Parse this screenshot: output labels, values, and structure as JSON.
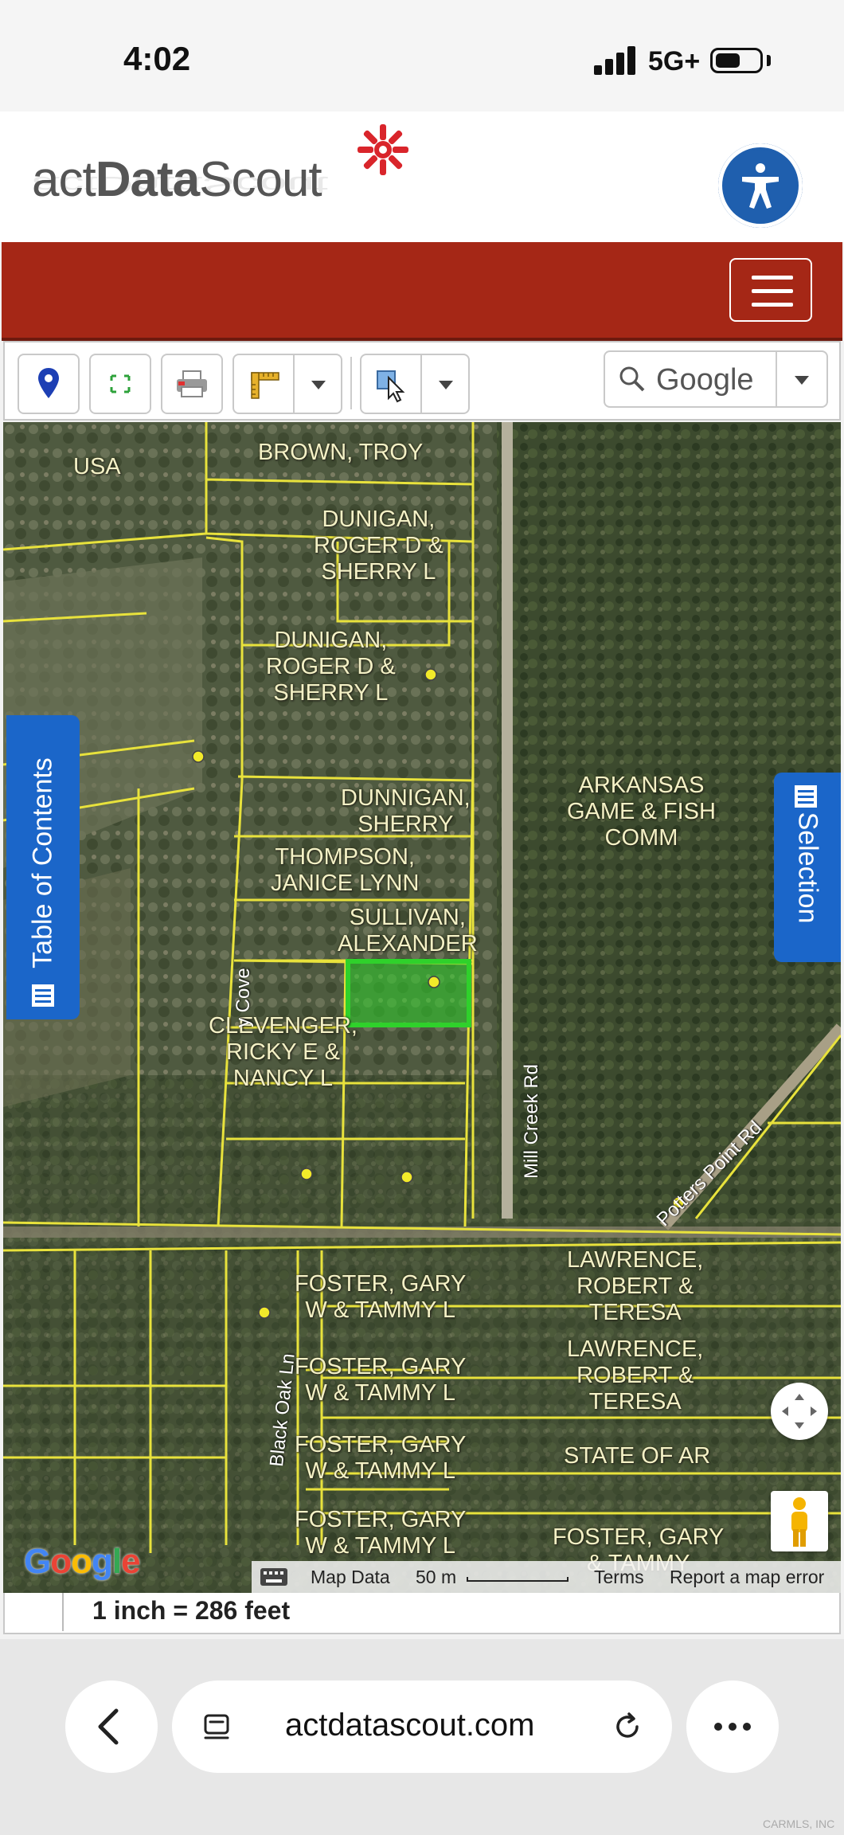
{
  "status_bar": {
    "time": "4:02",
    "network": "5G+"
  },
  "header": {
    "logo_prefix": "act",
    "logo_bold": "Data",
    "logo_suffix": "Scout",
    "accent_color": "#a52716"
  },
  "toolbar": {
    "search_engine_label": "Google"
  },
  "side_tabs": {
    "table_of_contents": "Table of Contents",
    "selection": "Selection"
  },
  "map": {
    "parcels": [
      {
        "label": "USA"
      },
      {
        "label": "BROWN, TROY"
      },
      {
        "line1": "DUNIGAN,",
        "line2": "ROGER D &",
        "line3": "SHERRY L"
      },
      {
        "line1": "DUNIGAN,",
        "line2": "ROGER D &",
        "line3": "SHERRY L"
      },
      {
        "line1": "DUNNIGAN,",
        "line2": "SHERRY"
      },
      {
        "line1": "ARKANSAS",
        "line2": "GAME & FISH",
        "line3": "COMM"
      },
      {
        "line1": "THOMPSON,",
        "line2": "JANICE LYNN"
      },
      {
        "line1": "SULLIVAN,",
        "line2": "ALEXANDER"
      },
      {
        "line1": "CLEVENGER,",
        "line2": "RICKY E &",
        "line3": "NANCY L"
      },
      {
        "line1": "FOSTER, GARY",
        "line2": "W & TAMMY L"
      },
      {
        "line1": "LAWRENCE,",
        "line2": "ROBERT &",
        "line3": "TERESA"
      },
      {
        "line1": "FOSTER, GARY",
        "line2": "W & TAMMY L"
      },
      {
        "line1": "LAWRENCE,",
        "line2": "ROBERT &",
        "line3": "TERESA"
      },
      {
        "line1": "FOSTER, GARY",
        "line2": "W & TAMMY L"
      },
      {
        "label": "STATE OF AR"
      },
      {
        "line1": "FOSTER, GARY",
        "line2": "W & TAMMY L"
      },
      {
        "line1": "FOSTER, GARY",
        "line2": "& TAMMY"
      }
    ],
    "roads": {
      "mill_creek": "Mill Creek Rd",
      "potters_point": "Potters Point Rd",
      "black_oak": "Black Oak Ln",
      "cove": "y Cove"
    },
    "footer": {
      "map_data": "Map Data",
      "scale": "50 m",
      "terms": "Terms",
      "report": "Report a map error"
    },
    "google": "Google",
    "scale_text": "1 inch = 286 feet",
    "selected_parcel_color": "#2fd12b",
    "parcel_line_color": "#e8e23c"
  },
  "browser": {
    "url": "actdatascout.com"
  },
  "watermark": "CARMLS, INC"
}
